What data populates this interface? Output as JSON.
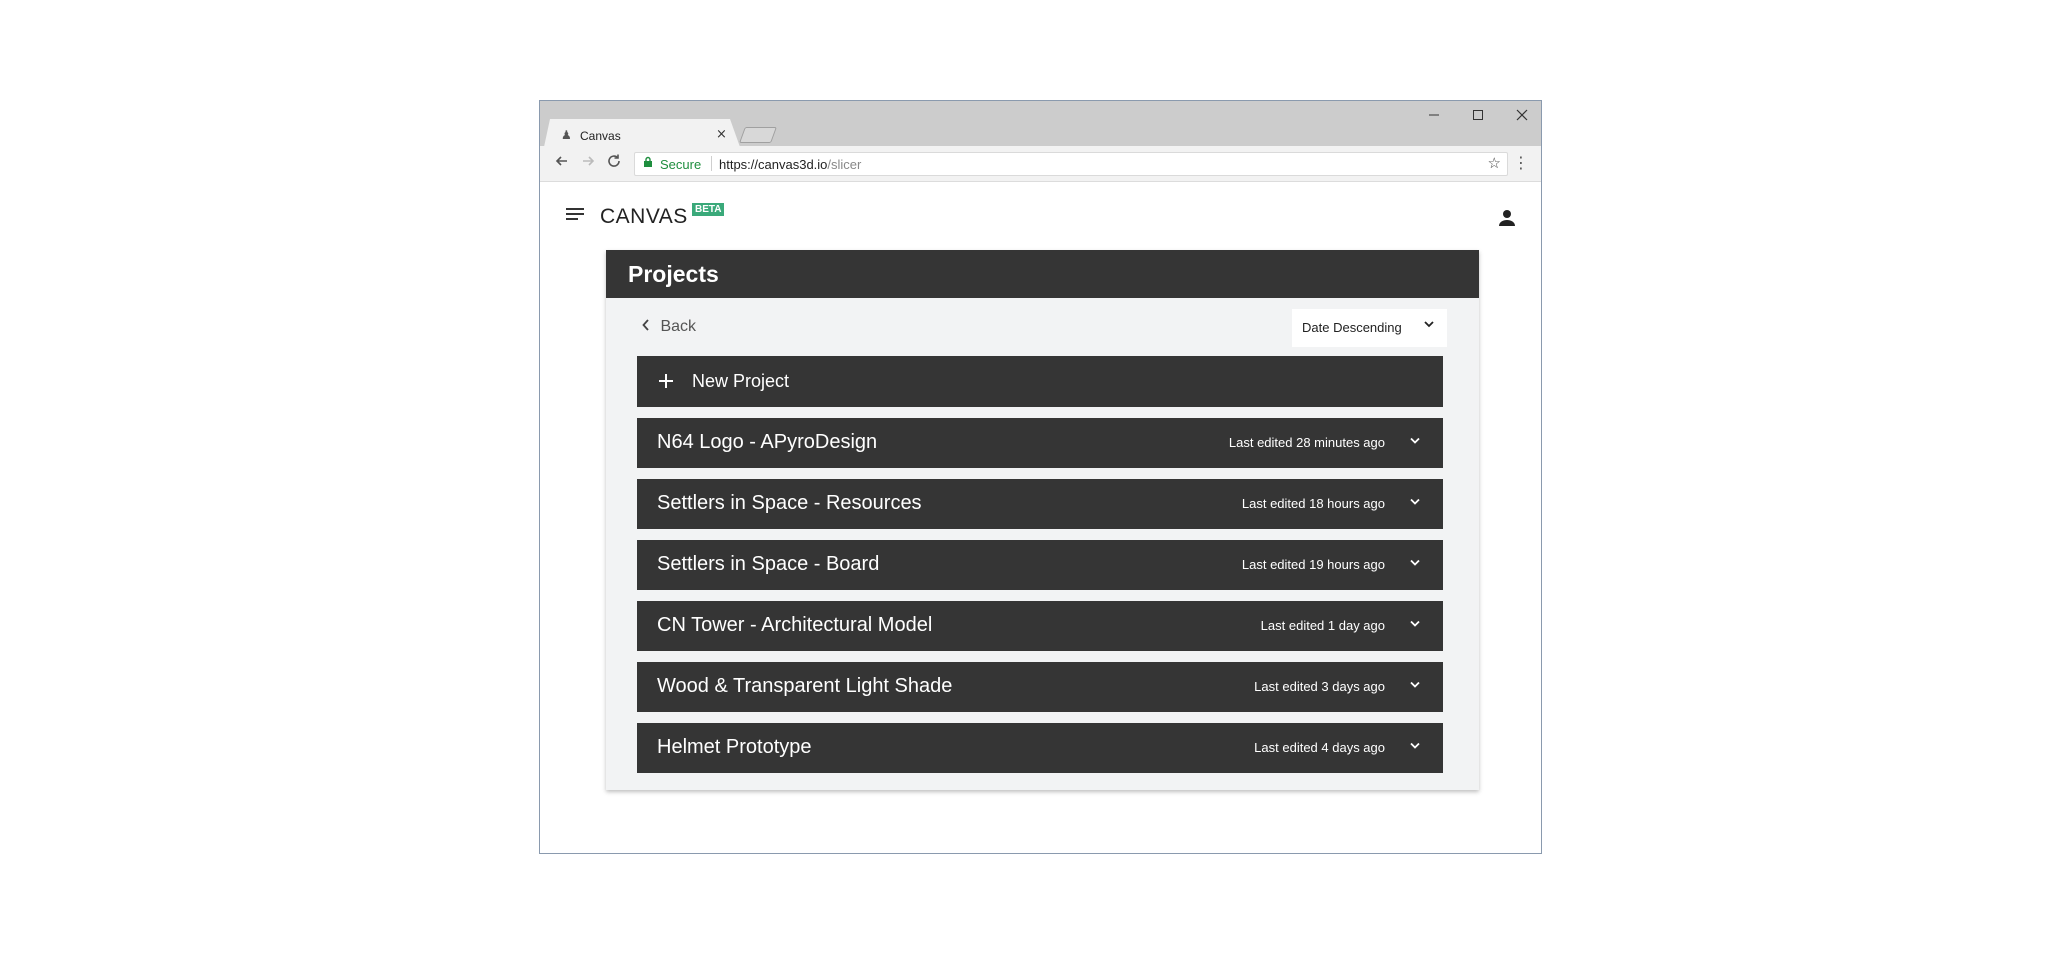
{
  "browser": {
    "tab_title": "Canvas",
    "tab_close": "×",
    "minimize": "—",
    "maximize": "☐",
    "close": "✕",
    "secure_label": "Secure",
    "url_host": "https://canvas3d.io",
    "url_path": "/slicer"
  },
  "app": {
    "logo": "CANVAS",
    "beta": "BETA"
  },
  "projects": {
    "title": "Projects",
    "back_label": "Back",
    "sort_label": "Date Descending",
    "new_project_label": "New Project",
    "items": [
      {
        "name": "N64 Logo - APyroDesign",
        "edited": "Last edited 28 minutes ago"
      },
      {
        "name": "Settlers in Space - Resources",
        "edited": "Last edited 18 hours ago"
      },
      {
        "name": "Settlers in Space - Board",
        "edited": "Last edited 19 hours ago"
      },
      {
        "name": "CN Tower - Architectural Model",
        "edited": "Last edited 1 day ago"
      },
      {
        "name": "Wood & Transparent Light Shade",
        "edited": "Last edited 3 days ago"
      },
      {
        "name": "Helmet Prototype",
        "edited": "Last edited 4 days ago"
      }
    ]
  }
}
